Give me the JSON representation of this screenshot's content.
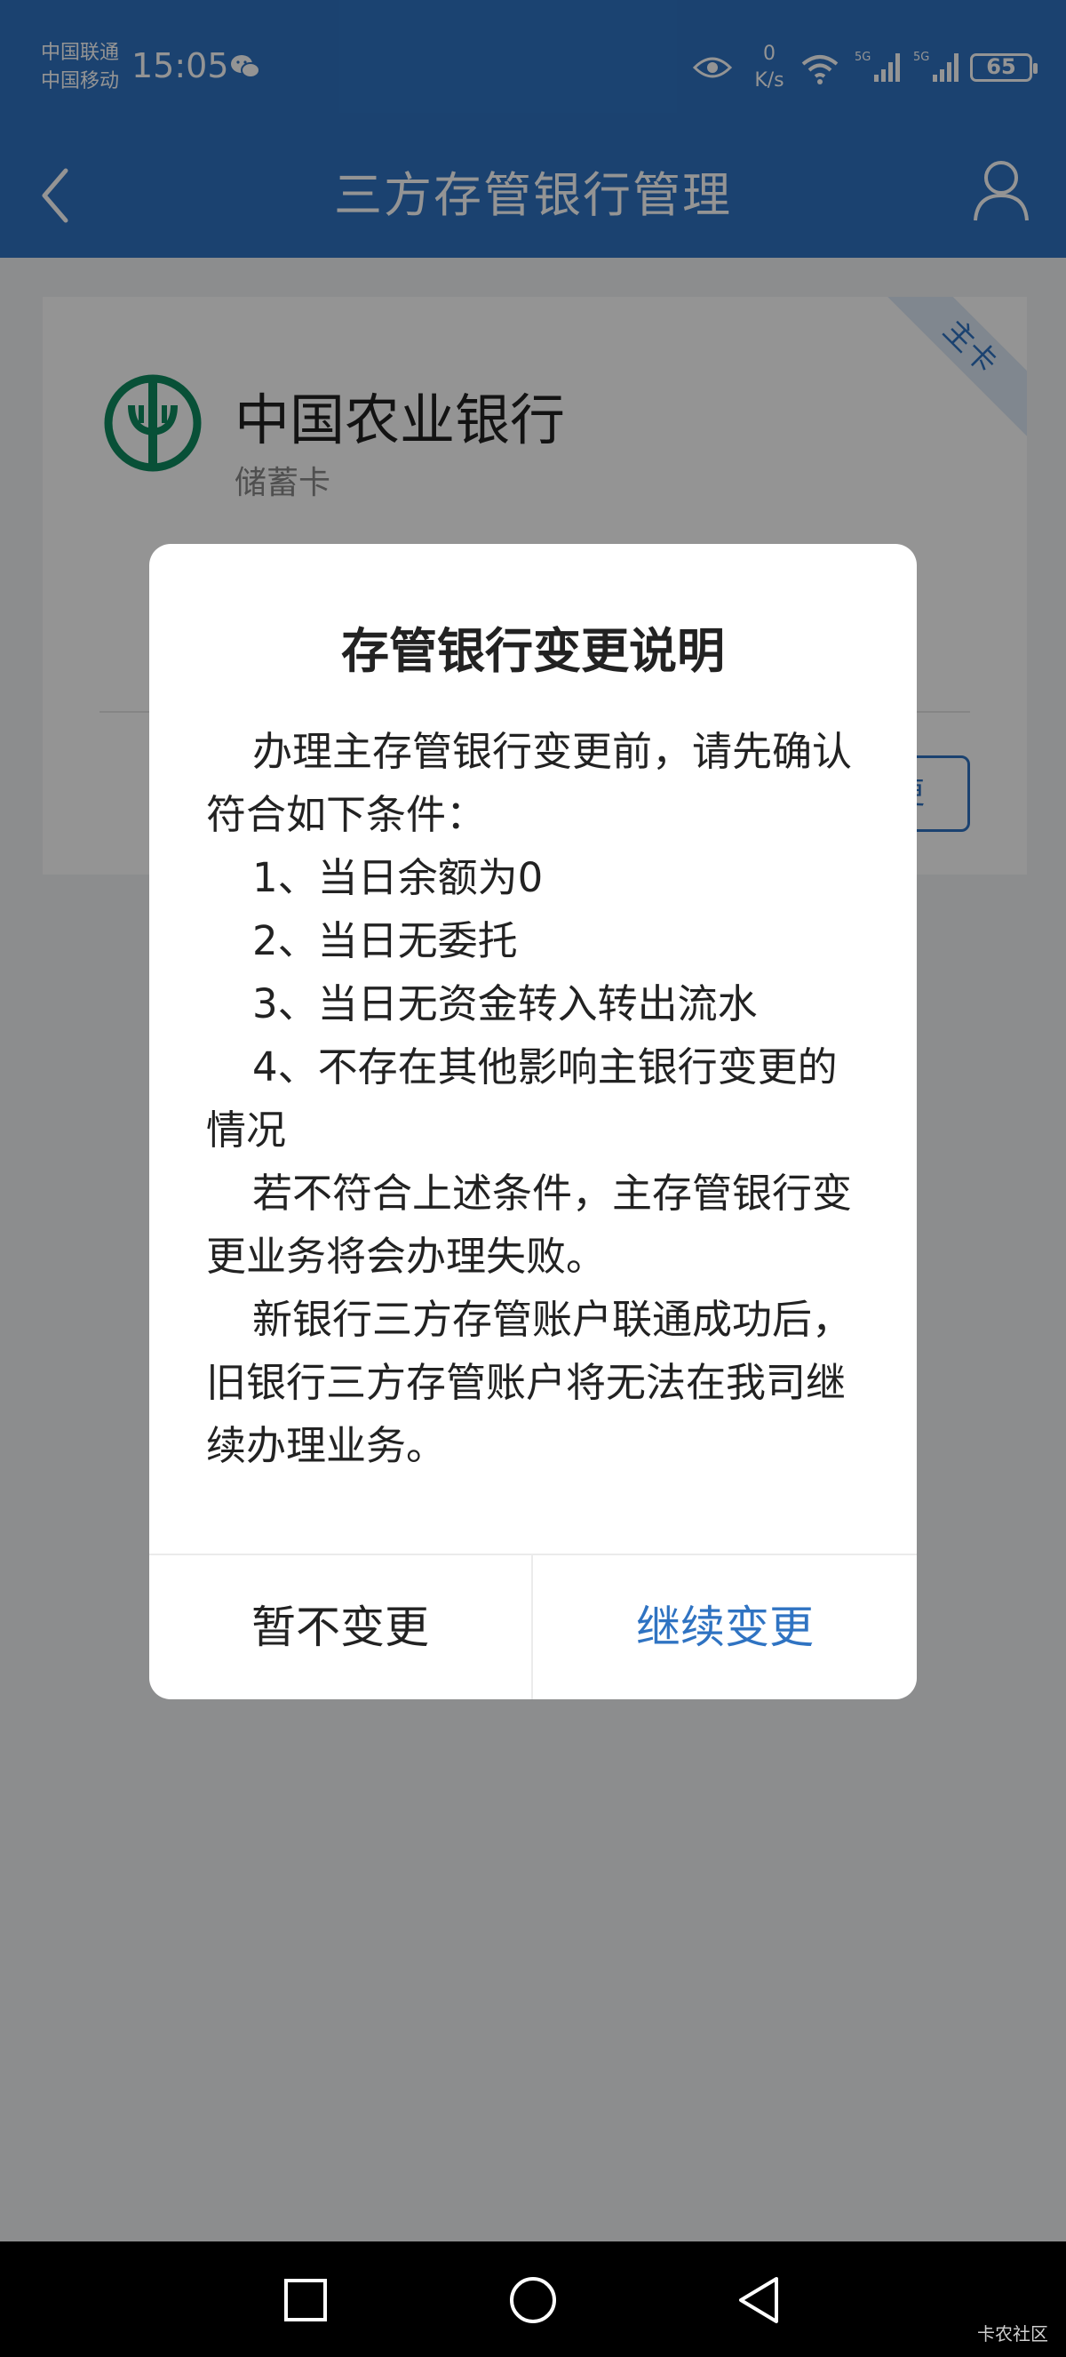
{
  "status_bar": {
    "carrier_1": "中国联通",
    "carrier_2": "中国移动",
    "time": "15:05",
    "speed_value": "0",
    "speed_unit": "K/s",
    "network_1": "5G",
    "network_2": "5G",
    "battery": "65",
    "icons": [
      "wechat-icon",
      "eye-icon",
      "wifi-icon",
      "signal-icon",
      "battery-icon"
    ]
  },
  "nav": {
    "title": "三方存管银行管理",
    "icons": [
      "back-arrow-icon",
      "user-icon"
    ]
  },
  "bank_card": {
    "ribbon": "主卡",
    "bank_name": "中国农业银行",
    "card_type": "储蓄卡",
    "action_label": "变更"
  },
  "dialog": {
    "title": "存管银行变更说明",
    "paragraphs": [
      "办理主存管银行变更前，请先确认符合如下条件：",
      "1、当日余额为0",
      "2、当日无委托",
      "3、当日无资金转入转出流水",
      "4、不存在其他影响主银行变更的情况",
      "若不符合上述条件，主存管银行变更业务将会办理失败。",
      "新银行三方存管账户联通成功后，旧银行三方存管账户将无法在我司继续办理业务。"
    ],
    "cancel_label": "暂不变更",
    "confirm_label": "继续变更"
  },
  "system_nav": {
    "icons": [
      "recent-apps-icon",
      "home-icon",
      "back-icon"
    ],
    "watermark": "卡农社区"
  },
  "colors": {
    "primary": "#2f73c2",
    "overlay": "rgba(0,0,0,0.42)",
    "bank_green": "#0f8a5f"
  }
}
